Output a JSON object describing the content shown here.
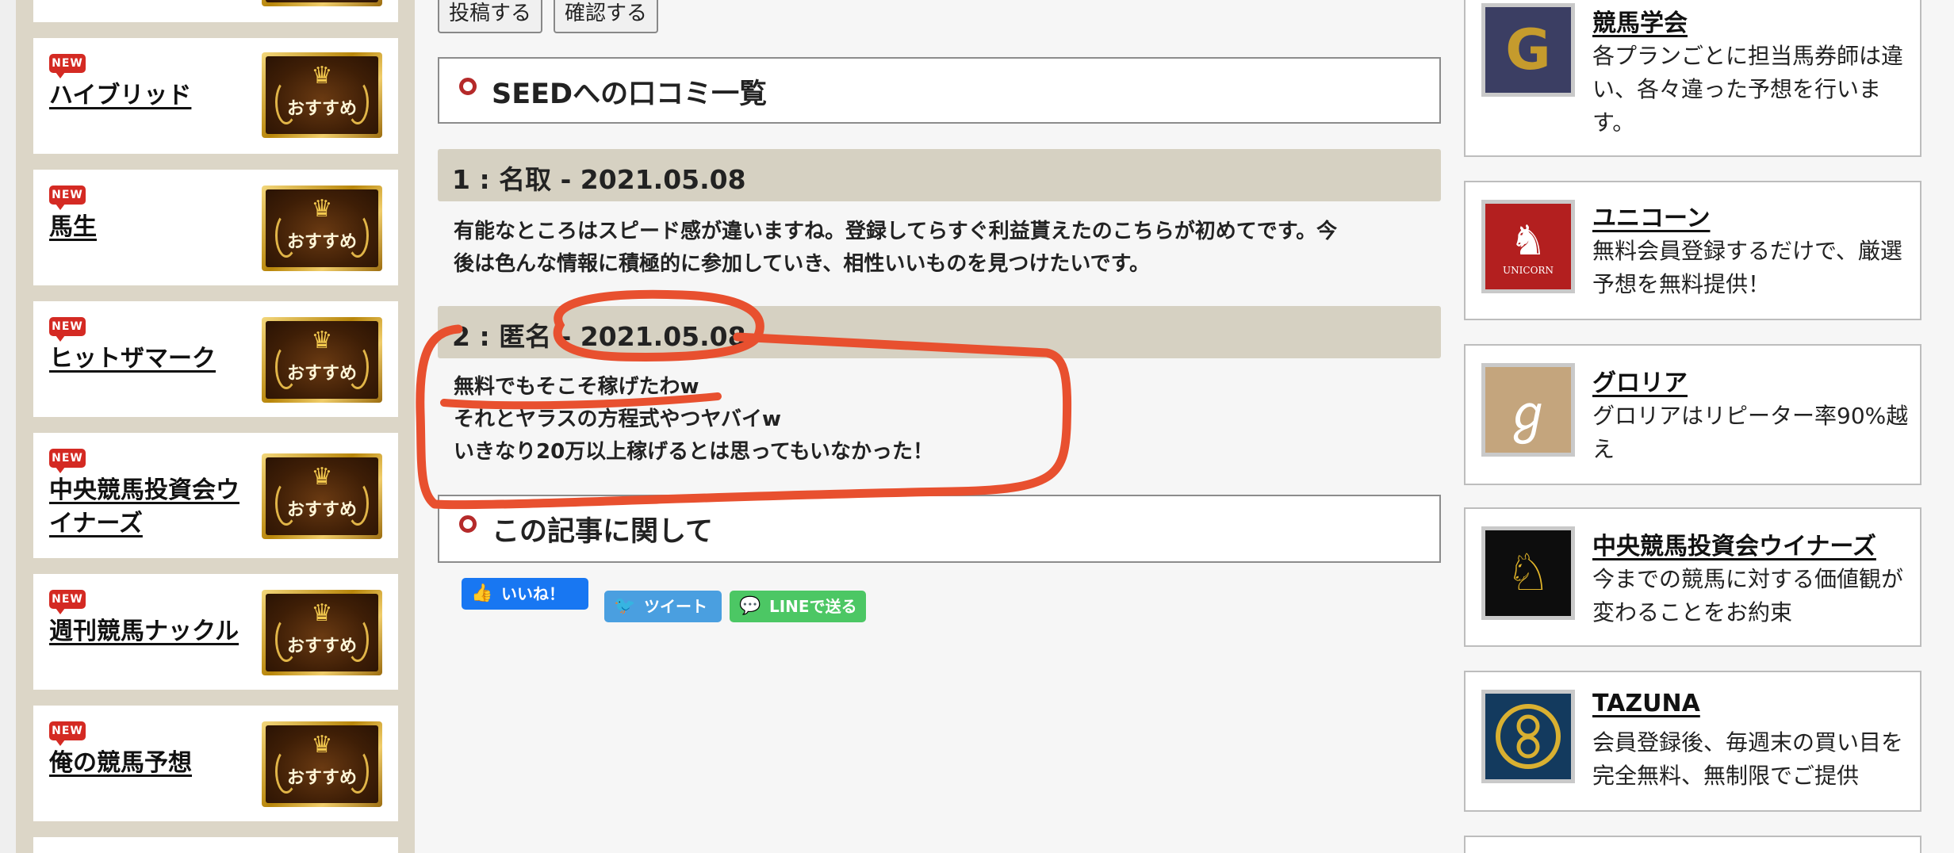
{
  "sidebar": {
    "new_label": "NEW",
    "recommend_label": "おすすめ",
    "items": [
      {
        "name": "ハイブリッド"
      },
      {
        "name": "馬生"
      },
      {
        "name": "ヒットザマーク"
      },
      {
        "name": "中央競馬投資会ウイナーズ"
      },
      {
        "name": "週刊競馬ナックル"
      },
      {
        "name": "俺の競馬予想"
      }
    ]
  },
  "main": {
    "post_button": "投稿する",
    "confirm_button": "確認する",
    "reviews_title": "SEEDへの口コミ一覧",
    "reviews": [
      {
        "header": "1 : 名取 - 2021.05.08",
        "body": "有能なところはスピード感が違いますね。登録してらすぐ利益貰えたのこちらが初めてです。今\n後は色んな情報に積極的に参加していき、相性いいものを見つけたいです。"
      },
      {
        "header": "2 : 匿名 - 2021.05.08",
        "body": "無料でもそこそ稼げたわw\nそれとヤラスの方程式やつヤバイw\nいきなり20万以上稼げるとは思ってもいなかった！"
      }
    ],
    "article_title": "この記事に関して",
    "social": {
      "like": "いいね！",
      "tweet": "ツイート",
      "line": "LINEで送る"
    }
  },
  "right_sidebar": {
    "items": [
      {
        "title": "競馬学会",
        "desc": "各プランごとに担当馬券師は違い、各々違った予想を行います。",
        "logo_color": "#3b3e63"
      },
      {
        "title": "ユニコーン",
        "desc": "無料会員登録するだけで、厳選予想を無料提供！",
        "logo_color": "#b31f1f",
        "logo_text": "UNICORN"
      },
      {
        "title": "グロリア",
        "desc": "グロリアはリピーター率90%越え",
        "logo_color": "#c4a57d"
      },
      {
        "title": "中央競馬投資会ウイナーズ",
        "desc": "今までの競馬に対する価値観が変わることをお約束",
        "logo_color": "#0d0d0d"
      },
      {
        "title": "TAZUNA",
        "desc": "会員登録後、毎週末の買い目を完全無料、無制限でご提供",
        "logo_color": "#133a5e"
      }
    ]
  },
  "colors": {
    "annotation": "#e8502f",
    "new_badge": "#d42a23",
    "review_header_bg": "#d6d1c2",
    "like": "#1877f2",
    "tweet": "#4a9fe0",
    "line": "#4cc764"
  }
}
